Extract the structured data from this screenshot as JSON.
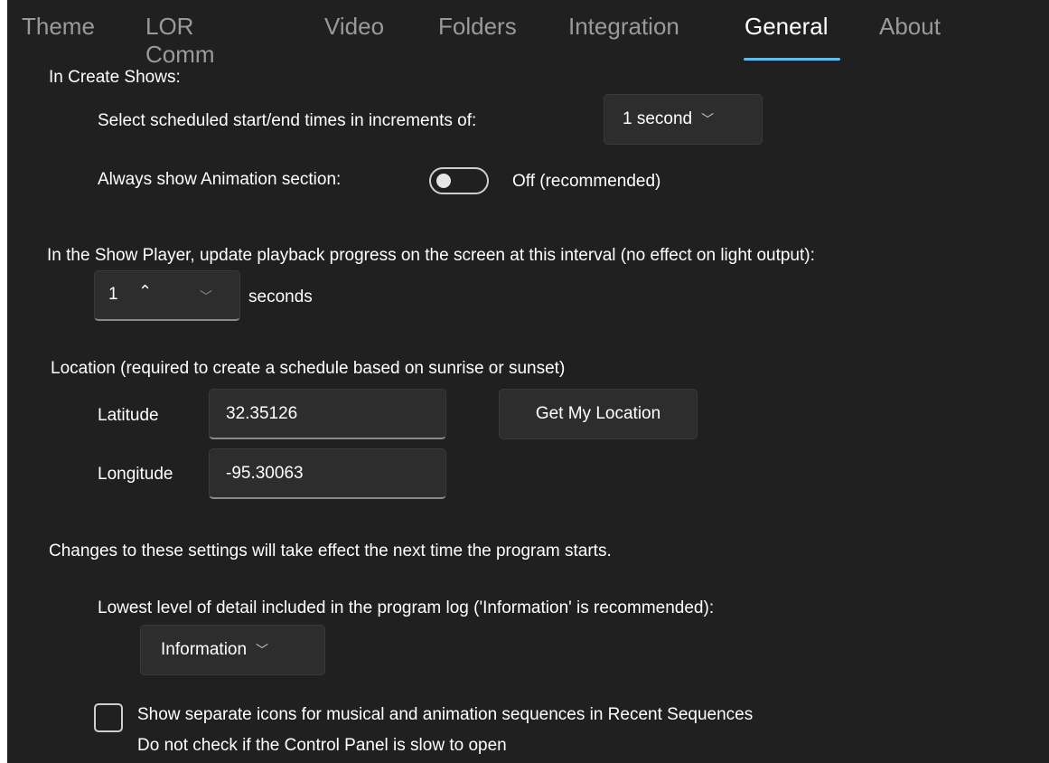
{
  "tabs": [
    {
      "label": "Theme"
    },
    {
      "label": "LOR Comm"
    },
    {
      "label": "Video"
    },
    {
      "label": "Folders"
    },
    {
      "label": "Integration"
    },
    {
      "label": "General"
    },
    {
      "label": "About"
    }
  ],
  "active_tab": "General",
  "create_shows": {
    "heading": "In Create Shows:",
    "increment_label": "Select scheduled start/end times in increments of:",
    "increment_value": "1 second",
    "animation_label": "Always show Animation section:",
    "animation_toggle_state": "Off (recommended)",
    "animation_toggle_on": false
  },
  "show_player": {
    "label": "In the Show Player, update playback progress on the screen at this interval (no effect on light output):",
    "interval_value": "1",
    "interval_unit": "seconds"
  },
  "location": {
    "heading": "Location (required to create a schedule based on sunrise or sunset)",
    "latitude_label": "Latitude",
    "latitude_value": "32.35126",
    "longitude_label": "Longitude",
    "longitude_value": "-95.30063",
    "get_location_button": "Get My Location"
  },
  "restart_notice": "Changes to these settings will take effect the next time the program starts.",
  "log": {
    "label": "Lowest level of detail included in the program log ('Information' is recommended):",
    "value": "Information"
  },
  "separate_icons": {
    "label_line1": "Show separate icons for musical and animation sequences in Recent Sequences",
    "label_line2": "Do not check if the Control Panel is slow to open",
    "checked": false
  },
  "colors": {
    "background": "#202020",
    "accent": "#4cc2ff",
    "inactive_tab": "#9a9a9a"
  }
}
